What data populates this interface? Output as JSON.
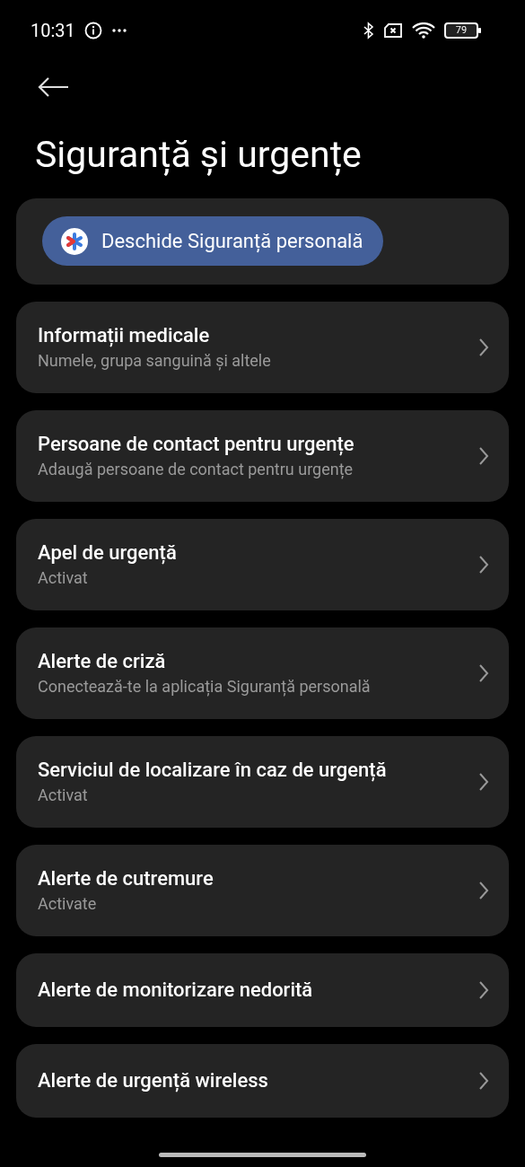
{
  "status_bar": {
    "time": "10:31",
    "battery": "79"
  },
  "title": "Siguranță și urgențe",
  "open_button": {
    "label": "Deschide Siguranță personală"
  },
  "items": [
    {
      "title": "Informații medicale",
      "subtitle": "Numele, grupa sanguină și altele"
    },
    {
      "title": "Persoane de contact pentru urgențe",
      "subtitle": "Adaugă persoane de contact pentru urgențe"
    },
    {
      "title": "Apel de urgență",
      "subtitle": "Activat"
    },
    {
      "title": "Alerte de criză",
      "subtitle": "Conectează-te la aplicația Siguranță personală"
    },
    {
      "title": "Serviciul de localizare în caz de urgență",
      "subtitle": "Activat"
    },
    {
      "title": "Alerte de cutremure",
      "subtitle": "Activate"
    },
    {
      "title": "Alerte de monitorizare nedorită"
    },
    {
      "title": "Alerte de urgență wireless"
    }
  ]
}
